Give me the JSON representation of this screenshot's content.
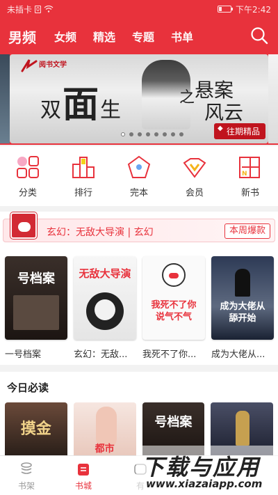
{
  "status": {
    "carrier": "未插卡",
    "sim": "0",
    "time": "下午2:42"
  },
  "topnav": {
    "tabs": [
      {
        "label": "男频",
        "active": true
      },
      {
        "label": "女频"
      },
      {
        "label": "精选"
      },
      {
        "label": "专题"
      },
      {
        "label": "书单"
      }
    ],
    "search_icon": "search-icon"
  },
  "banner": {
    "publisher": "阅书文学",
    "title_small": "双",
    "title_big": "面",
    "title_tail": "生",
    "connector": "之",
    "subtitle_line1": "悬案",
    "subtitle_line2": "风云",
    "badge": "往期精品",
    "dots": 8,
    "active_dot": 0
  },
  "quicknav": [
    {
      "label": "分类",
      "icon": "category-icon"
    },
    {
      "label": "排行",
      "icon": "ranking-icon"
    },
    {
      "label": "完本",
      "icon": "completed-icon"
    },
    {
      "label": "会员",
      "icon": "vip-crown-icon"
    },
    {
      "label": "新书",
      "icon": "new-book-icon"
    }
  ],
  "hot": {
    "text": "玄幻：无敌大导演 | 玄幻",
    "tag": "本周爆款",
    "books": [
      {
        "title": "一号档案",
        "cover_text": "号档案"
      },
      {
        "title": "玄幻：无敌...",
        "cover_text": "无敌大导演"
      },
      {
        "title": "我死不了你...",
        "cover_text": "我死不了你说气不气"
      },
      {
        "title": "成为大佬从...",
        "cover_text": "成为大佬从舔开始"
      }
    ]
  },
  "daily": {
    "title": "今日必读",
    "books": [
      {
        "cover_text": "摸金"
      },
      {
        "cover_text": "都市"
      },
      {
        "cover_text": "号档案"
      },
      {
        "cover_text": ""
      }
    ]
  },
  "bottombar": [
    {
      "label": "书架",
      "icon": "bookshelf-icon"
    },
    {
      "label": "书城",
      "icon": "bookstore-icon",
      "active": true
    },
    {
      "label": "有",
      "icon": "listen-icon"
    }
  ],
  "watermark": {
    "main": "下载与应用",
    "url": "www.xiazaiapp.com"
  },
  "colors": {
    "accent": "#e8323c"
  }
}
